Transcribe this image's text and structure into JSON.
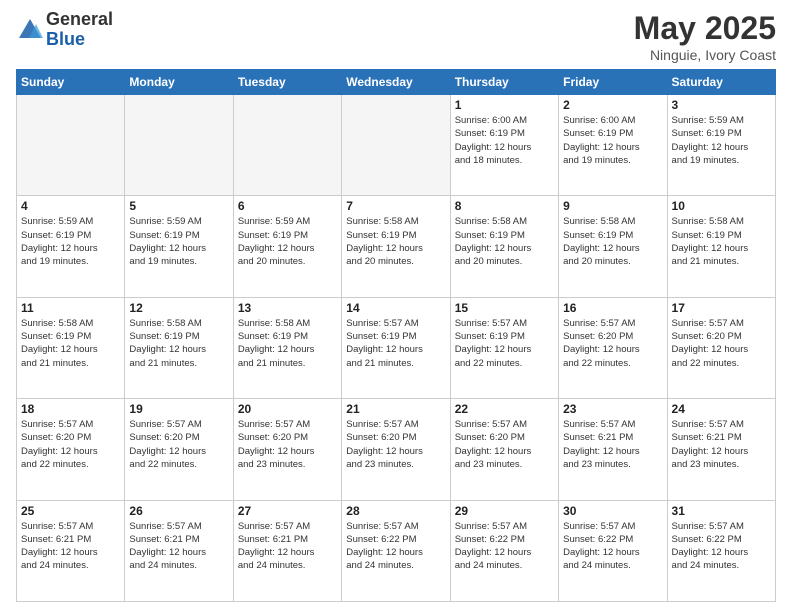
{
  "header": {
    "logo_general": "General",
    "logo_blue": "Blue",
    "title": "May 2025",
    "location": "Ninguie, Ivory Coast"
  },
  "days_of_week": [
    "Sunday",
    "Monday",
    "Tuesday",
    "Wednesday",
    "Thursday",
    "Friday",
    "Saturday"
  ],
  "weeks": [
    [
      {
        "day": "",
        "info": ""
      },
      {
        "day": "",
        "info": ""
      },
      {
        "day": "",
        "info": ""
      },
      {
        "day": "",
        "info": ""
      },
      {
        "day": "1",
        "info": "Sunrise: 6:00 AM\nSunset: 6:19 PM\nDaylight: 12 hours\nand 18 minutes."
      },
      {
        "day": "2",
        "info": "Sunrise: 6:00 AM\nSunset: 6:19 PM\nDaylight: 12 hours\nand 19 minutes."
      },
      {
        "day": "3",
        "info": "Sunrise: 5:59 AM\nSunset: 6:19 PM\nDaylight: 12 hours\nand 19 minutes."
      }
    ],
    [
      {
        "day": "4",
        "info": "Sunrise: 5:59 AM\nSunset: 6:19 PM\nDaylight: 12 hours\nand 19 minutes."
      },
      {
        "day": "5",
        "info": "Sunrise: 5:59 AM\nSunset: 6:19 PM\nDaylight: 12 hours\nand 19 minutes."
      },
      {
        "day": "6",
        "info": "Sunrise: 5:59 AM\nSunset: 6:19 PM\nDaylight: 12 hours\nand 20 minutes."
      },
      {
        "day": "7",
        "info": "Sunrise: 5:58 AM\nSunset: 6:19 PM\nDaylight: 12 hours\nand 20 minutes."
      },
      {
        "day": "8",
        "info": "Sunrise: 5:58 AM\nSunset: 6:19 PM\nDaylight: 12 hours\nand 20 minutes."
      },
      {
        "day": "9",
        "info": "Sunrise: 5:58 AM\nSunset: 6:19 PM\nDaylight: 12 hours\nand 20 minutes."
      },
      {
        "day": "10",
        "info": "Sunrise: 5:58 AM\nSunset: 6:19 PM\nDaylight: 12 hours\nand 21 minutes."
      }
    ],
    [
      {
        "day": "11",
        "info": "Sunrise: 5:58 AM\nSunset: 6:19 PM\nDaylight: 12 hours\nand 21 minutes."
      },
      {
        "day": "12",
        "info": "Sunrise: 5:58 AM\nSunset: 6:19 PM\nDaylight: 12 hours\nand 21 minutes."
      },
      {
        "day": "13",
        "info": "Sunrise: 5:58 AM\nSunset: 6:19 PM\nDaylight: 12 hours\nand 21 minutes."
      },
      {
        "day": "14",
        "info": "Sunrise: 5:57 AM\nSunset: 6:19 PM\nDaylight: 12 hours\nand 21 minutes."
      },
      {
        "day": "15",
        "info": "Sunrise: 5:57 AM\nSunset: 6:19 PM\nDaylight: 12 hours\nand 22 minutes."
      },
      {
        "day": "16",
        "info": "Sunrise: 5:57 AM\nSunset: 6:20 PM\nDaylight: 12 hours\nand 22 minutes."
      },
      {
        "day": "17",
        "info": "Sunrise: 5:57 AM\nSunset: 6:20 PM\nDaylight: 12 hours\nand 22 minutes."
      }
    ],
    [
      {
        "day": "18",
        "info": "Sunrise: 5:57 AM\nSunset: 6:20 PM\nDaylight: 12 hours\nand 22 minutes."
      },
      {
        "day": "19",
        "info": "Sunrise: 5:57 AM\nSunset: 6:20 PM\nDaylight: 12 hours\nand 22 minutes."
      },
      {
        "day": "20",
        "info": "Sunrise: 5:57 AM\nSunset: 6:20 PM\nDaylight: 12 hours\nand 23 minutes."
      },
      {
        "day": "21",
        "info": "Sunrise: 5:57 AM\nSunset: 6:20 PM\nDaylight: 12 hours\nand 23 minutes."
      },
      {
        "day": "22",
        "info": "Sunrise: 5:57 AM\nSunset: 6:20 PM\nDaylight: 12 hours\nand 23 minutes."
      },
      {
        "day": "23",
        "info": "Sunrise: 5:57 AM\nSunset: 6:21 PM\nDaylight: 12 hours\nand 23 minutes."
      },
      {
        "day": "24",
        "info": "Sunrise: 5:57 AM\nSunset: 6:21 PM\nDaylight: 12 hours\nand 23 minutes."
      }
    ],
    [
      {
        "day": "25",
        "info": "Sunrise: 5:57 AM\nSunset: 6:21 PM\nDaylight: 12 hours\nand 24 minutes."
      },
      {
        "day": "26",
        "info": "Sunrise: 5:57 AM\nSunset: 6:21 PM\nDaylight: 12 hours\nand 24 minutes."
      },
      {
        "day": "27",
        "info": "Sunrise: 5:57 AM\nSunset: 6:21 PM\nDaylight: 12 hours\nand 24 minutes."
      },
      {
        "day": "28",
        "info": "Sunrise: 5:57 AM\nSunset: 6:22 PM\nDaylight: 12 hours\nand 24 minutes."
      },
      {
        "day": "29",
        "info": "Sunrise: 5:57 AM\nSunset: 6:22 PM\nDaylight: 12 hours\nand 24 minutes."
      },
      {
        "day": "30",
        "info": "Sunrise: 5:57 AM\nSunset: 6:22 PM\nDaylight: 12 hours\nand 24 minutes."
      },
      {
        "day": "31",
        "info": "Sunrise: 5:57 AM\nSunset: 6:22 PM\nDaylight: 12 hours\nand 24 minutes."
      }
    ]
  ]
}
